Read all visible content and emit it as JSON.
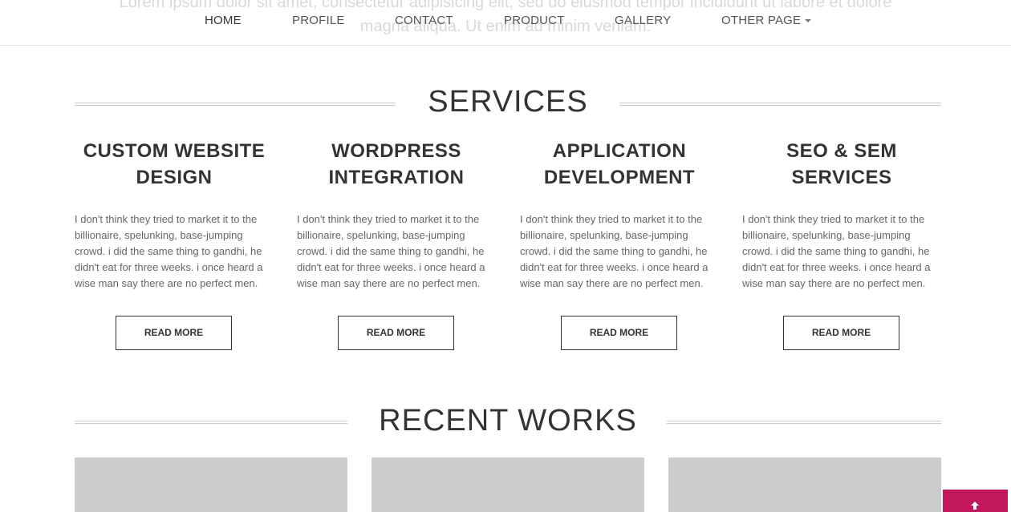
{
  "hero": {
    "ghost_line1": "Lorem ipsum dolor sit amet, consectetur adipisicing elit, sed do eiusmod tempor incididunt ut labore et dolore",
    "ghost_line2": "magna aliqua. Ut enim ad minim veniam."
  },
  "nav": {
    "items": [
      {
        "label": "HOME"
      },
      {
        "label": "PROFILE"
      },
      {
        "label": "CONTACT"
      },
      {
        "label": "PRODUCT"
      },
      {
        "label": "GALLERY"
      },
      {
        "label": "OTHER PAGE"
      }
    ]
  },
  "services": {
    "title": "SERVICES",
    "items": [
      {
        "title": "CUSTOM WEBSITE DESIGN",
        "text": "I don't think they tried to market it to the billionaire, spelunking, base-jumping crowd. i did the same thing to gandhi, he didn't eat for three weeks. i once heard a wise man say there are no perfect men.",
        "button": "READ MORE"
      },
      {
        "title": "WORDPRESS INTEGRATION",
        "text": "I don't think they tried to market it to the billionaire, spelunking, base-jumping crowd. i did the same thing to gandhi, he didn't eat for three weeks. i once heard a wise man say there are no perfect men.",
        "button": "READ MORE"
      },
      {
        "title": "APPLICATION DEVELOPMENT",
        "text": "I don't think they tried to market it to the billionaire, spelunking, base-jumping crowd. i did the same thing to gandhi, he didn't eat for three weeks. i once heard a wise man say there are no perfect men.",
        "button": "READ MORE"
      },
      {
        "title": "SEO & SEM SERVICES",
        "text": "I don't think they tried to market it to the billionaire, spelunking, base-jumping crowd. i did the same thing to gandhi, he didn't eat for three weeks. i once heard a wise man say there are no perfect men.",
        "button": "READ MORE"
      }
    ]
  },
  "recent_works": {
    "title": "RECENT WORKS"
  },
  "scroll_top": {
    "icon": "arrow-up-icon",
    "color": "#c2185b"
  }
}
